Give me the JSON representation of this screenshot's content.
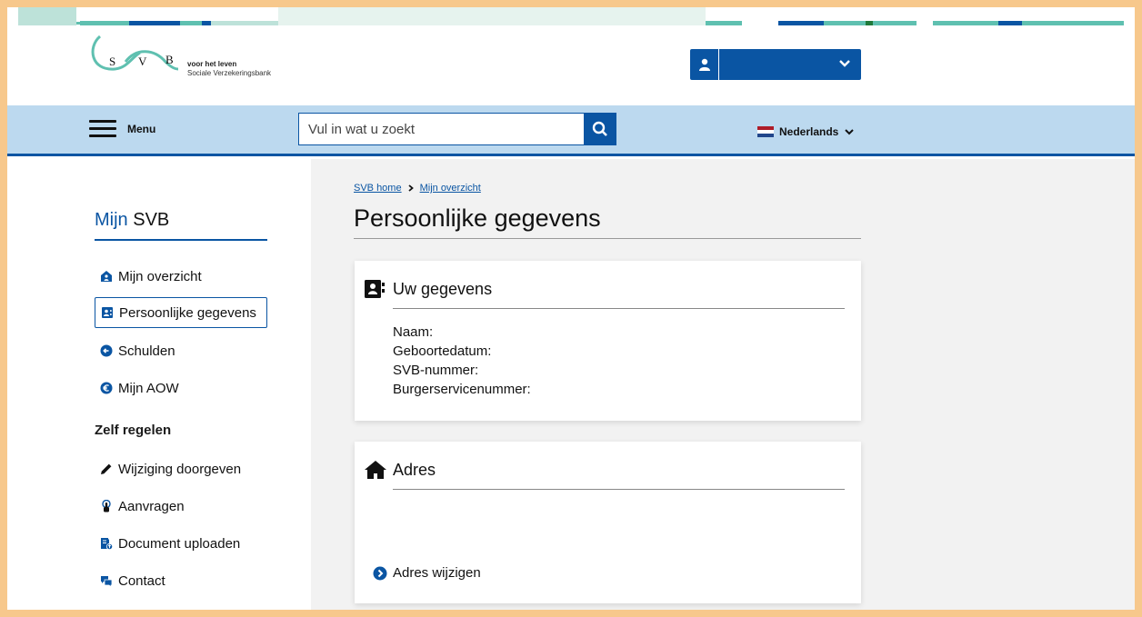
{
  "brand": {
    "letters": [
      "S",
      "V",
      "B"
    ],
    "tagline": "voor het leven",
    "name": "Sociale Verzekeringsbank",
    "colors": {
      "primary": "#0a55a3",
      "teal": "#5fc0b0",
      "nav": "#bcd9ef"
    }
  },
  "header": {
    "user_button_icon": "user-icon",
    "user_button_chevron": "chevron-down-icon"
  },
  "nav": {
    "menu_label": "Menu",
    "search_placeholder": "Vul in wat u zoekt",
    "language": "Nederlands"
  },
  "sidebar": {
    "title_part1": "Mijn",
    "title_part2": "SVB",
    "items": [
      {
        "label": "Mijn overzicht",
        "icon": "home-icon"
      },
      {
        "label": "Persoonlijke gegevens",
        "icon": "contact-card-icon",
        "active": true
      },
      {
        "label": "Schulden",
        "icon": "arrow-circle-icon"
      },
      {
        "label": "Mijn AOW",
        "icon": "euro-circle-icon"
      }
    ],
    "section_heading": "Zelf regelen",
    "section_items": [
      {
        "label": "Wijziging doorgeven",
        "icon": "pencil-icon"
      },
      {
        "label": "Aanvragen",
        "icon": "hand-pointer-icon"
      },
      {
        "label": "Document uploaden",
        "icon": "document-upload-icon"
      },
      {
        "label": "Contact",
        "icon": "chat-icon"
      }
    ]
  },
  "breadcrumb": {
    "home": "SVB home",
    "current": "Mijn overzicht"
  },
  "main": {
    "title": "Persoonlijke gegevens",
    "card_gegevens": {
      "heading": "Uw gegevens",
      "fields": [
        "Naam:",
        "Geboortedatum:",
        "SVB-nummer:",
        "Burgerservicenummer:"
      ]
    },
    "card_adres": {
      "heading": "Adres",
      "link": "Adres wijzigen"
    }
  }
}
